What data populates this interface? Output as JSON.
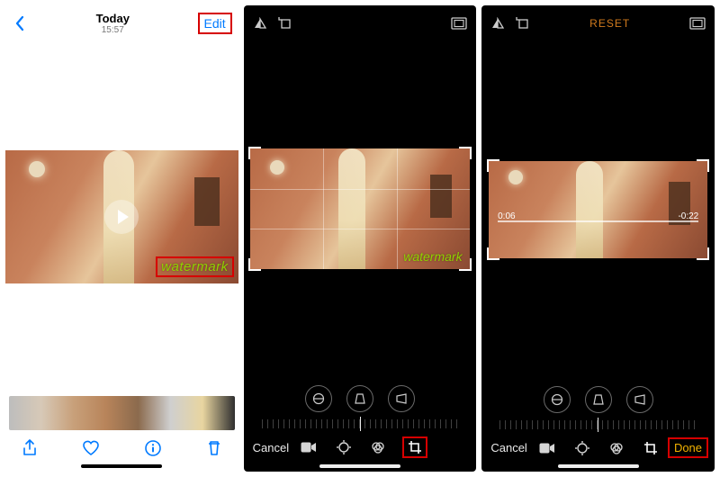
{
  "screen1": {
    "title": "Today",
    "subtitle": "15:57",
    "edit": "Edit",
    "watermark": "watermark"
  },
  "screen2": {
    "watermark": "watermark",
    "cancel": "Cancel"
  },
  "screen3": {
    "reset": "RESET",
    "time_elapsed": "0:06",
    "time_remaining": "-0:22",
    "cancel": "Cancel",
    "done": "Done"
  }
}
